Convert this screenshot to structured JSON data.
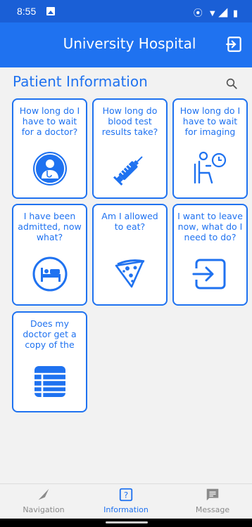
{
  "status_bar": {
    "time": "8:55"
  },
  "app_bar": {
    "title": "University Hospital"
  },
  "section": {
    "title": "Patient Information"
  },
  "cards": [
    {
      "label": "How long do I have to wait for a doctor?",
      "icon": "doctor-icon"
    },
    {
      "label": "How long do blood test results take?",
      "icon": "syringe-icon"
    },
    {
      "label": "How long do I have to wait for imaging",
      "icon": "waiting-patient-icon"
    },
    {
      "label": "I have been admitted, now what?",
      "icon": "hospital-bed-icon"
    },
    {
      "label": "Am I allowed to eat?",
      "icon": "pizza-icon"
    },
    {
      "label": "I want to leave now, what do I need to do?",
      "icon": "exit-icon"
    },
    {
      "label": "Does my doctor get a copy of the",
      "icon": "list-icon"
    }
  ],
  "bottom_nav": {
    "items": [
      {
        "label": "Navigation",
        "icon": "compass-icon"
      },
      {
        "label": "Information",
        "icon": "question-box-icon"
      },
      {
        "label": "Message",
        "icon": "message-icon"
      }
    ]
  },
  "colors": {
    "primary": "#1f72f0",
    "background": "#f2f2f2",
    "inactive": "#8a8a8a"
  }
}
